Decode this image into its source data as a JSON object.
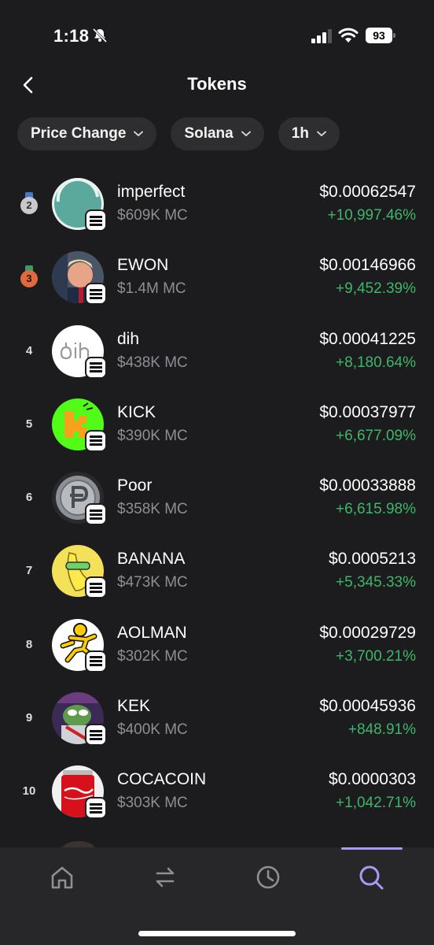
{
  "status_bar": {
    "time": "1:18",
    "battery": "93"
  },
  "header": {
    "title": "Tokens"
  },
  "filters": [
    {
      "label": "Price Change"
    },
    {
      "label": "Solana"
    },
    {
      "label": "1h"
    }
  ],
  "tokens": [
    {
      "rank": "2",
      "name": "imperfect",
      "mc": "$609K MC",
      "price": "$0.00062547",
      "change": "+10,997.46%"
    },
    {
      "rank": "3",
      "name": "EWON",
      "mc": "$1.4M MC",
      "price": "$0.00146966",
      "change": "+9,452.39%"
    },
    {
      "rank": "4",
      "name": "dih",
      "mc": "$438K MC",
      "price": "$0.00041225",
      "change": "+8,180.64%"
    },
    {
      "rank": "5",
      "name": "KICK",
      "mc": "$390K MC",
      "price": "$0.00037977",
      "change": "+6,677.09%"
    },
    {
      "rank": "6",
      "name": "Poor",
      "mc": "$358K MC",
      "price": "$0.00033888",
      "change": "+6,615.98%"
    },
    {
      "rank": "7",
      "name": "BANANA",
      "mc": "$473K MC",
      "price": "$0.0005213",
      "change": "+5,345.33%"
    },
    {
      "rank": "8",
      "name": "AOLMAN",
      "mc": "$302K MC",
      "price": "$0.00029729",
      "change": "+3,700.21%"
    },
    {
      "rank": "9",
      "name": "KEK",
      "mc": "$400K MC",
      "price": "$0.00045936",
      "change": "+848.91%"
    },
    {
      "rank": "10",
      "name": "COCACOIN",
      "mc": "$303K MC",
      "price": "$0.0000303",
      "change": "+1,042.71%"
    }
  ],
  "nav": {
    "items": [
      "home-icon",
      "swap-icon",
      "history-icon",
      "search-icon"
    ],
    "active": "search-icon",
    "accent": "#a99bf5"
  },
  "colors": {
    "positive": "#3eb66a",
    "muted": "#8e8e93",
    "background": "#1c1c1e"
  }
}
